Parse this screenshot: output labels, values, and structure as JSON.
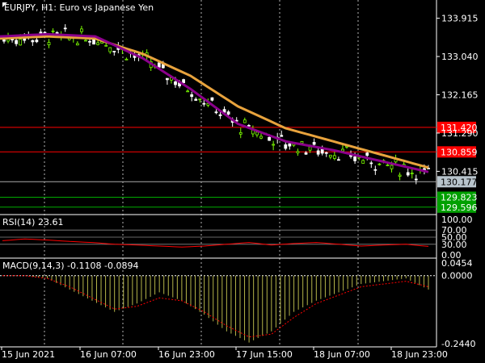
{
  "chart_title": "EURJPY, H1:  Euro vs Japanese Yen",
  "rsi_title": "RSI(14) 23.61",
  "macd_title": "MACD(9,14,3) -0.1108 -0.0894",
  "colors": {
    "background": "#000000",
    "grid": "#ffffff",
    "bull_candle": "#7cfc00",
    "bear_candle": "#ffffff",
    "ma_fast": "#8b008b",
    "ma_slow": "#e8a33d",
    "level_red": "#ff0000",
    "level_green": "#00aa00",
    "level_gray": "#aaaaaa",
    "rsi_line": "#ff0000",
    "macd_hist": "#b5b54a",
    "macd_signal": "#ff0000"
  },
  "chart_data": [
    {
      "type": "line",
      "x": [
        "15 Jun 2021",
        "16 Jun 07:00",
        "16 Jun 23:00",
        "17 Jun 15:00",
        "18 Jun 07:00",
        "18 Jun 23:00"
      ],
      "ylim": [
        129.5,
        134.0
      ],
      "y_ticks": [
        "133.915",
        "133.040",
        "132.165",
        "131.290",
        "130.415"
      ],
      "series": [
        {
          "values": [
            133.5,
            133.55,
            133.5,
            133.0,
            132.3,
            131.5,
            131.1,
            130.9,
            130.65,
            130.4
          ]
        },
        {
          "values": [
            133.45,
            133.5,
            133.45,
            133.1,
            132.6,
            131.9,
            131.4,
            131.1,
            130.8,
            130.5
          ]
        }
      ],
      "levels": [
        {
          "value": "131.420",
          "color": "#ff0000"
        },
        {
          "value": "130.859",
          "color": "#ff0000"
        },
        {
          "value": "130.177",
          "color": "#aaaaaa"
        },
        {
          "value": "129.823",
          "color": "#00aa00"
        },
        {
          "value": "129.596",
          "color": "#00aa00"
        }
      ]
    },
    {
      "type": "line",
      "ylim": [
        0,
        100
      ],
      "y_ticks": [
        "100.00",
        "70.00",
        "50.00",
        "30.00",
        "0.00"
      ],
      "series": [
        {
          "values": [
            40,
            45,
            42,
            38,
            35,
            30,
            28,
            25,
            22,
            25,
            30,
            35,
            28,
            32,
            35,
            30,
            25,
            28,
            30,
            24
          ]
        }
      ]
    },
    {
      "type": "bar",
      "ylim": [
        -0.244,
        0.0454
      ],
      "y_ticks": [
        "0.0454",
        "0.0000",
        "-0.2440"
      ],
      "series": [
        {
          "values": [
            0.0,
            0.0,
            -0.01,
            -0.05,
            -0.09,
            -0.13,
            -0.1,
            -0.06,
            -0.09,
            -0.14,
            -0.2,
            -0.24,
            -0.2,
            -0.13,
            -0.09,
            -0.06,
            -0.03,
            -0.02,
            -0.01,
            -0.05
          ]
        },
        {
          "values": [
            0.0,
            0.0,
            -0.01,
            -0.04,
            -0.08,
            -0.12,
            -0.11,
            -0.08,
            -0.09,
            -0.13,
            -0.18,
            -0.22,
            -0.21,
            -0.15,
            -0.1,
            -0.07,
            -0.04,
            -0.03,
            -0.02,
            -0.04
          ]
        }
      ]
    }
  ]
}
